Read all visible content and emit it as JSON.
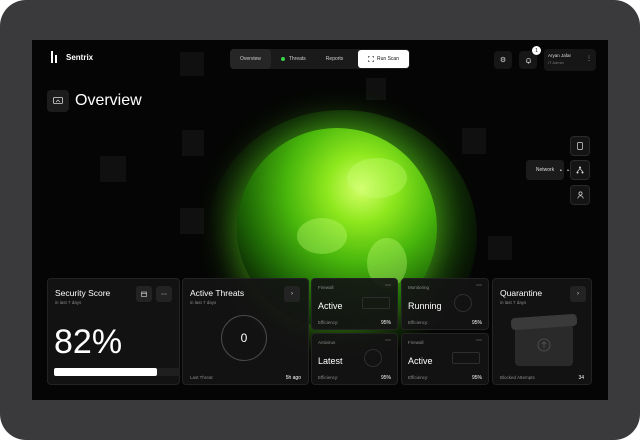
{
  "app": {
    "name": "Sentrix"
  },
  "nav": {
    "tabs": [
      {
        "label": "Overview",
        "active": true
      },
      {
        "label": "Threats",
        "active": false,
        "status_color": "#38d34b"
      },
      {
        "label": "Reports",
        "active": false
      }
    ],
    "scan_button": "Run Scan"
  },
  "header_actions": {
    "settings_icon": "gear-icon",
    "notifications_icon": "bell-icon",
    "notification_count": "1"
  },
  "user": {
    "name": "Aryan Jafar",
    "role": "IT Admin"
  },
  "page": {
    "title": "Overview",
    "icon": "monitor-icon"
  },
  "side_panel": {
    "items": [
      {
        "icon": "device-icon"
      },
      {
        "icon": "network-icon",
        "tooltip": "Network"
      },
      {
        "icon": "user-icon"
      }
    ]
  },
  "cards": {
    "security_score": {
      "title": "Security Score",
      "subtitle": "in last 7 days",
      "value": "82%",
      "progress": 0.82
    },
    "active_threats": {
      "title": "Active Threats",
      "subtitle": "in last 7 days",
      "value": "0",
      "footer_label": "Last Threat",
      "footer_value": "5h ago"
    },
    "firewall_top": {
      "label": "Firewall",
      "state": "Active",
      "footer_label": "Efficiency:",
      "footer_value": "95%"
    },
    "monitoring": {
      "label": "Monitoring",
      "state": "Running",
      "footer_label": "Efficiency:",
      "footer_value": "95%"
    },
    "antivirus": {
      "label": "Antivirus",
      "state": "Latest",
      "footer_label": "Efficiency:",
      "footer_value": "95%"
    },
    "firewall_bottom": {
      "label": "Firewall",
      "state": "Active",
      "footer_label": "Efficiency:",
      "footer_value": "95%"
    },
    "quarantine": {
      "title": "Quarantine",
      "subtitle": "in last 7 days",
      "footer_label": "Blocked Attempts",
      "footer_value": "34"
    }
  },
  "colors": {
    "accent": "#7cff2a",
    "background": "#050505",
    "card": "#141414"
  }
}
